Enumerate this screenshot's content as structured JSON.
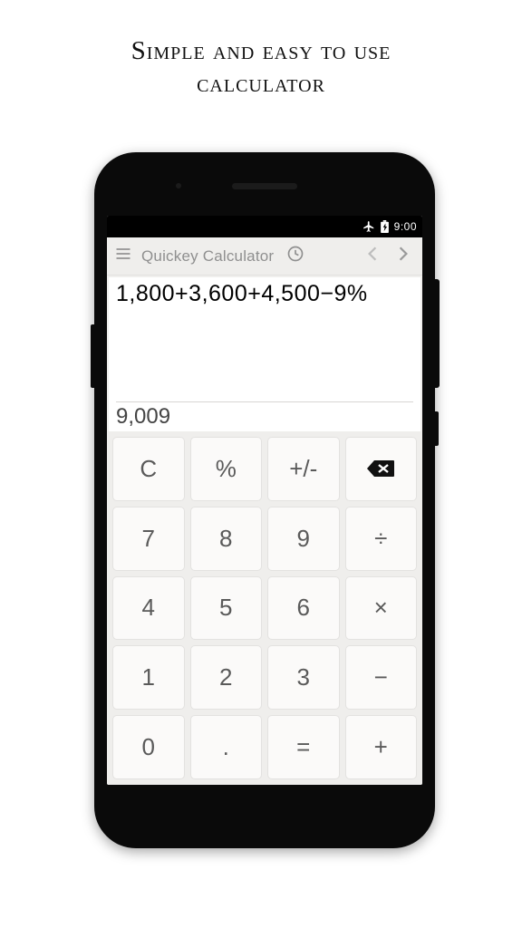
{
  "headline_line1": "Simple and easy to use",
  "headline_line2": "calculator",
  "statusbar": {
    "time": "9:00"
  },
  "appbar": {
    "title": "Quickey Calculator"
  },
  "display": {
    "expression": "1,800+3,600+4,500−9%",
    "result": "9,009"
  },
  "keys": {
    "c": "C",
    "pct": "%",
    "pm": "+/-",
    "7": "7",
    "8": "8",
    "9": "9",
    "div": "÷",
    "4": "4",
    "5": "5",
    "6": "6",
    "mul": "×",
    "1": "1",
    "2": "2",
    "3": "3",
    "sub": "−",
    "0": "0",
    "dot": ".",
    "eq": "=",
    "add": "+"
  }
}
